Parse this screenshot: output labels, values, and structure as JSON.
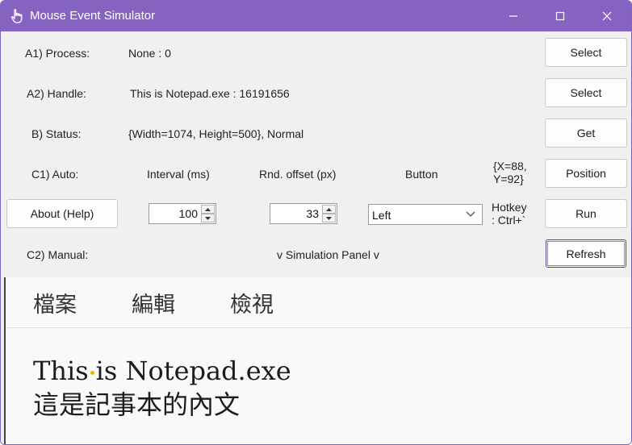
{
  "window": {
    "title": "Mouse Event Simulator",
    "icon": "hand-pointer-icon"
  },
  "rows": {
    "process": {
      "label": "A1) Process:",
      "value": "None : 0",
      "button": "Select"
    },
    "handle": {
      "label": "A2) Handle:",
      "value": "This is Notepad.exe : 16191656",
      "button": "Select"
    },
    "status": {
      "label": "B) Status:",
      "value": "{Width=1074, Height=500}, Normal",
      "button": "Get"
    },
    "auto": {
      "label": "C1) Auto:",
      "interval_label": "Interval (ms)",
      "offset_label": "Rnd. offset (px)",
      "button_label": "Button",
      "position_line1": "{X=88,",
      "position_line2": "Y=92}",
      "button": "Position"
    },
    "controls": {
      "about_button": "About (Help)",
      "interval_value": "100",
      "offset_value": "33",
      "mouse_button_selected": "Left",
      "hotkey_line1": "Hotkey",
      "hotkey_line2": ": Ctrl+`",
      "run_button": "Run"
    },
    "manual": {
      "label": "C2) Manual:",
      "panel_label": "v Simulation Panel v",
      "button": "Refresh"
    }
  },
  "notepad": {
    "menu": [
      "檔案",
      "編輯",
      "檢視"
    ],
    "line1_part1": "This",
    "line1_part2": "is Notepad.exe",
    "line2": "這是記事本的內文"
  },
  "colors": {
    "titlebar": "#8763c1",
    "window_bg": "#f0f0f0",
    "cursor_marker": "#f2b400"
  }
}
